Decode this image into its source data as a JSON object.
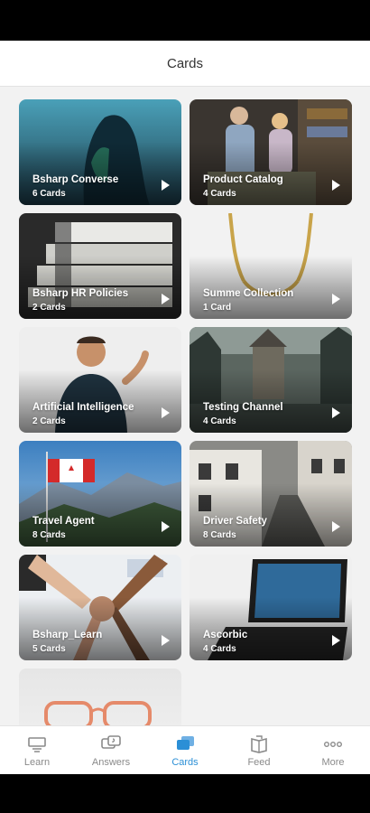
{
  "header": {
    "title": "Cards"
  },
  "cards": [
    {
      "title": "Bsharp Converse",
      "count": "6 Cards"
    },
    {
      "title": "Product Catalog",
      "count": "4 Cards"
    },
    {
      "title": "Bsharp HR Policies",
      "count": "2 Cards"
    },
    {
      "title": "Summe Collection",
      "count": "1 Card"
    },
    {
      "title": "Artificial Intelligence",
      "count": "2 Cards"
    },
    {
      "title": "Testing Channel",
      "count": "4 Cards"
    },
    {
      "title": "Travel Agent",
      "count": "8 Cards"
    },
    {
      "title": "Driver Safety",
      "count": "8 Cards"
    },
    {
      "title": "Bsharp_Learn",
      "count": "5 Cards"
    },
    {
      "title": "Ascorbic",
      "count": "4 Cards"
    }
  ],
  "tabbar": {
    "active": "Cards",
    "accent": "#2b8fd6",
    "items": [
      {
        "label": "Learn",
        "icon": "learn-icon"
      },
      {
        "label": "Answers",
        "icon": "answers-icon"
      },
      {
        "label": "Cards",
        "icon": "cards-icon"
      },
      {
        "label": "Feed",
        "icon": "feed-icon"
      },
      {
        "label": "More",
        "icon": "more-icon"
      }
    ]
  }
}
